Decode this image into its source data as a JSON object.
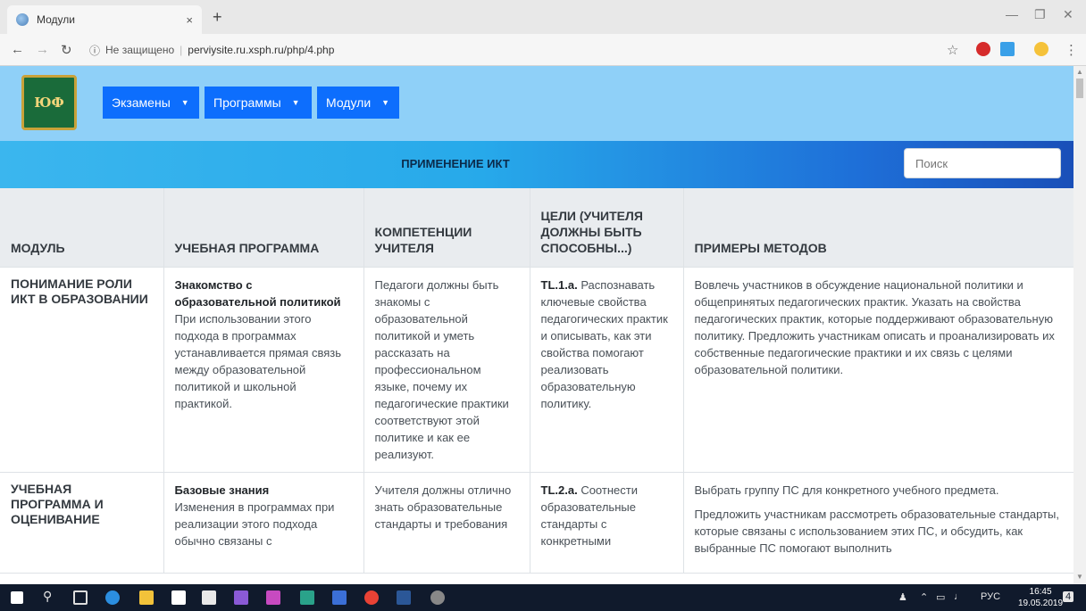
{
  "browser": {
    "tab_title": "Модули",
    "tab_close": "×",
    "new_tab": "+",
    "security": "Не защищено",
    "url": "perviysite.ru.xsph.ru/php/4.php"
  },
  "nav": {
    "menus": [
      {
        "label": "Экзамены"
      },
      {
        "label": "Программы"
      },
      {
        "label": "Модули"
      }
    ]
  },
  "page": {
    "title": "ПРИМЕНЕНИЕ ИКТ",
    "search_placeholder": "Поиск"
  },
  "table": {
    "headers": [
      "Модуль",
      "Учебная программа",
      "Компетенции учителя",
      "Цели (учителя должны быть способны...)",
      "Примеры методов"
    ],
    "rows": [
      {
        "module": "Понимание роли ИКТ в образовании",
        "program_title": "Знакомство с образовательной политикой",
        "program_text": "При использовании этого подхода в программах устанавливается прямая связь между образовательной политикой и школьной практикой.",
        "competence": "Педагоги должны быть знакомы с образовательной политикой и уметь рассказать на профессиональном языке, почему их педагогические практики соответствуют этой политике и как ее реализуют.",
        "goal_code": "TL.1.a.",
        "goal_text": "Распознавать ключевые свойства педагогических практик и описывать, как эти свойства помогают реализовать образовательную политику.",
        "methods": [
          "Вовлечь участников в обсуждение национальной политики и общепринятых педагогических практик. Указать на свойства педагогических практик, которые поддерживают образовательную политику. Предложить участникам описать и проанализировать их собственные педагогические практики и их связь с целями образовательной политики."
        ]
      },
      {
        "module": "Учебная программа и оценивание",
        "program_title": "Базовые знания",
        "program_text": "Изменения в программах при реализации этого подхода обычно связаны с",
        "competence": "Учителя должны отлично знать образовательные стандарты и требования",
        "goal_code": "TL.2.a.",
        "goal_text": "Соотнести образовательные стандарты с конкретными",
        "methods": [
          "Выбрать группу ПС для конкретного учебного предмета.",
          "Предложить участникам рассмотреть образовательные стандарты, которые связаны с использованием этих ПС, и обсудить, как выбранные ПС помогают выполнить"
        ]
      }
    ]
  },
  "taskbar": {
    "lang": "РУС",
    "time": "16:45",
    "date": "19.05.2019",
    "notifications": "4"
  }
}
